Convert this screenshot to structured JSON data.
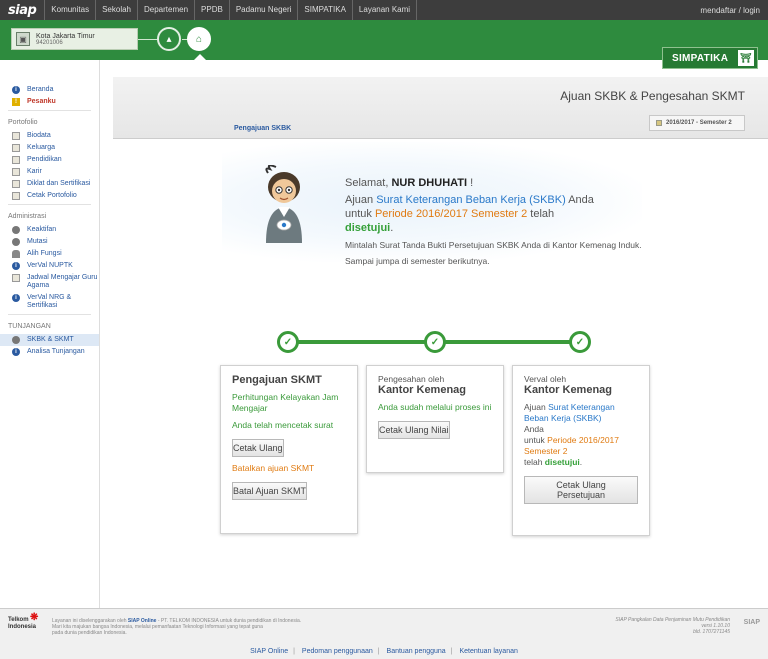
{
  "topbar": {
    "logo": "siap",
    "nav": [
      "Komunitas",
      "Sekolah",
      "Departemen",
      "PPDB",
      "Padamu Negeri",
      "SIMPATIKA",
      "Layanan Kami"
    ],
    "account": "mendaftar / login"
  },
  "school": {
    "name": "Kota Jakarta Timur",
    "code": "94201006"
  },
  "brand": {
    "simpatika": "SIMPATIKA"
  },
  "sidebar": {
    "top_items": [
      {
        "label": "Beranda",
        "icon": "info-icon"
      },
      {
        "label": "Pesanku",
        "icon": "alert-icon"
      }
    ],
    "portofolio_head": "Portofolio",
    "portofolio": [
      "Biodata",
      "Keluarga",
      "Pendidikan",
      "Karir",
      "Diklat dan Sertifikasi",
      "Cetak Portofolio"
    ],
    "administrasi_head": "Administrasi",
    "administrasi": [
      "Keaktifan",
      "Mutasi",
      "Alih Fungsi",
      "VerVal NUPTK",
      "Jadwal Mengajar Guru Agama",
      "VerVal NRG & Sertifikasi"
    ],
    "tunjangan_head": "TUNJANGAN",
    "tunjangan": [
      "SKBK & SKMT",
      "Analisa Tunjangan"
    ]
  },
  "header": {
    "title": "Ajuan SKBK & Pengesahan SKMT",
    "tab": "Pengajuan SKBK",
    "semester": "2016/2017 - Semester 2"
  },
  "welcome": {
    "greet": "Selamat, ",
    "name": "NUR DHUHATI",
    "excl": " !",
    "l1": "Ajuan ",
    "l1_link": "Surat Keterangan Beban Kerja (SKBK)",
    "l1_end": " Anda",
    "l2": "untuk ",
    "l2_period": "Periode 2016/2017 Semester 2",
    "l2_end": " telah",
    "approved": "disetujui",
    "approved_end": ".",
    "small1": "Mintalah Surat Tanda Bukti Persetujuan SKBK Anda di Kantor Kemenag Induk.",
    "small2": "Sampai jumpa di semester berikutnya."
  },
  "cards": {
    "c1": {
      "title": "Pengajuan SKMT",
      "p1": "Perhitungan Kelayakan Jam Mengajar",
      "p2": "Anda telah mencetak surat",
      "btn1": "Cetak Ulang",
      "p3": "Batalkan ajuan SKMT",
      "btn2": "Batal Ajuan SKMT"
    },
    "c2": {
      "sub": "Pengesahan oleh",
      "title": "Kantor Kemenag",
      "p1": "Anda sudah melalui proses ini",
      "btn": "Cetak Ulang Nilai"
    },
    "c3": {
      "sub": "Verval oleh",
      "title": "Kantor Kemenag",
      "a1": "Ajuan ",
      "a_link": "Surat Keterangan Beban Kerja (SKBK)",
      "a2": "Anda",
      "a3": "untuk ",
      "a_period": "Periode 2016/2017 Semester 2",
      "a4": "telah ",
      "a_ok": "disetujui",
      "a5": ".",
      "btn": "Cetak Ulang Persetujuan"
    }
  },
  "footer": {
    "telkom": "Telkom Indonesia",
    "text1_a": "Layanan ini diselenggarakan oleh ",
    "text1_b": "SIAP Online",
    "text1_c": " - PT. TELKOM INDONESIA untuk dunia pendidikan di Indonesia.",
    "text2": "Mari kita majukan bangsa Indonesia, melalui pemanfaatan Teknologi Informasi yang tepat guna",
    "text3": "pada dunia pendidikan Indonesia.",
    "right1": "SIAP Pangkalan Data Penjaminan Mutu Pendidikan",
    "right2": "versi 1.10.10",
    "right3": "bld. 1707271145",
    "logo": "SIAP",
    "links": [
      "SIAP Online",
      "Pedoman penggunaan",
      "Bantuan pengguna",
      "Ketentuan layanan"
    ]
  }
}
